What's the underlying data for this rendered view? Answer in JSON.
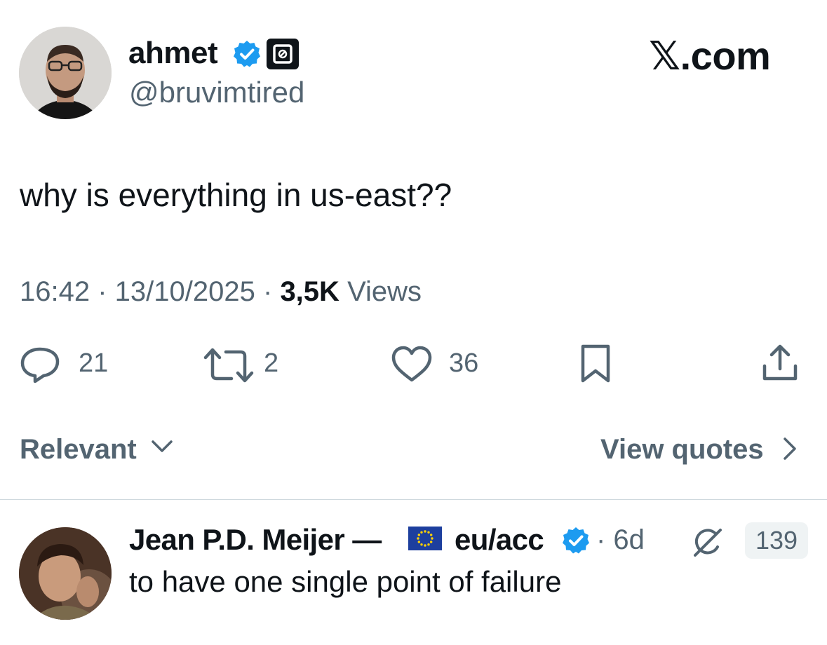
{
  "author": {
    "name": "ahmet",
    "handle": "@bruvimtired"
  },
  "site_logo": "𝕏.com",
  "tweet": {
    "text": "why is everything in us-east??",
    "time": "16:42",
    "date": "13/10/2025",
    "views_count": "3,5K",
    "views_label": "Views"
  },
  "actions": {
    "replies": "21",
    "reposts": "2",
    "likes": "36"
  },
  "filters": {
    "sort_label": "Relevant",
    "view_quotes_label": "View quotes"
  },
  "reply": {
    "name": "Jean P.D. Meijer —",
    "name_suffix": "eu/acc",
    "time": "· 6d",
    "badge_count": "139",
    "text": "to have one single point of failure"
  },
  "colors": {
    "primary_text": "#0f1419",
    "secondary_text": "#536471",
    "verified_blue": "#1d9bf0",
    "divider": "#cfd9de"
  }
}
